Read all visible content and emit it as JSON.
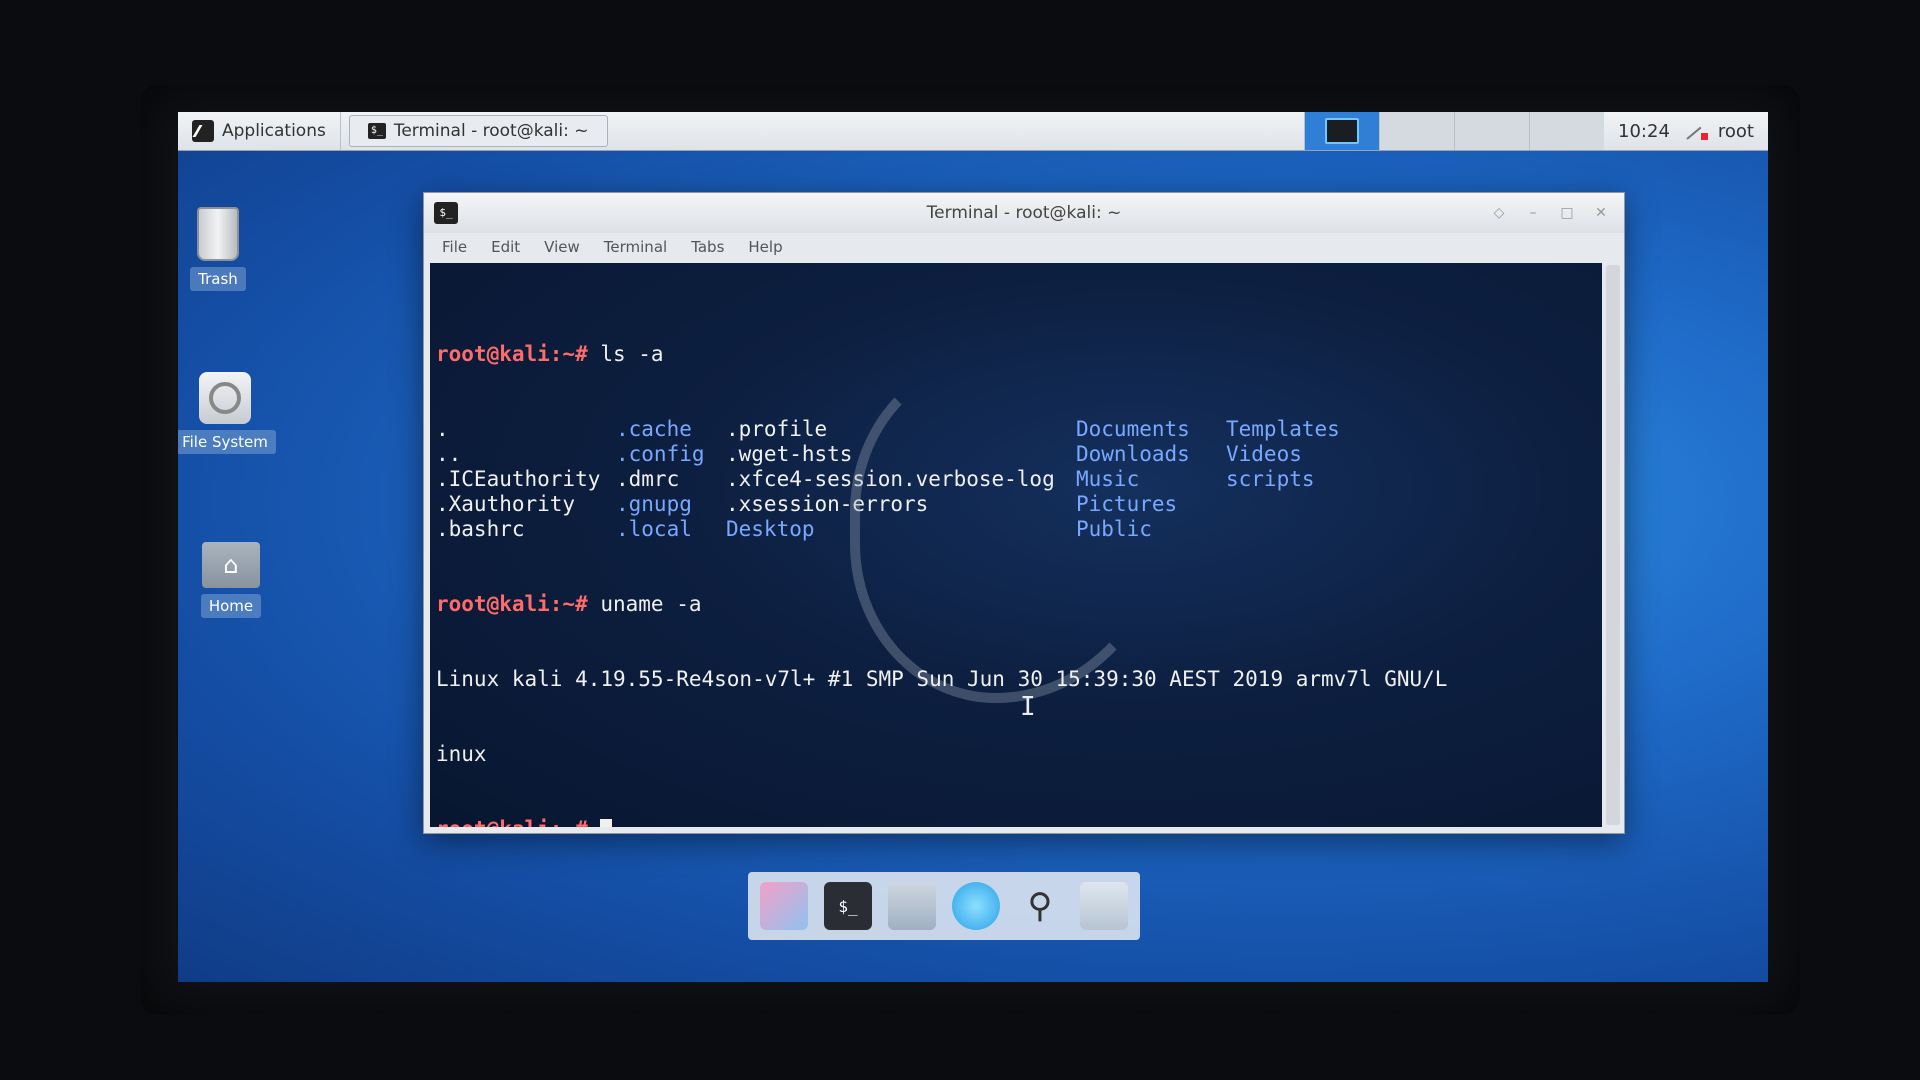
{
  "panel": {
    "applications_label": "Applications",
    "taskbar_label": "Terminal - root@kali: ~",
    "clock": "10:24",
    "user": "root"
  },
  "desktop_icons": {
    "trash": "Trash",
    "filesystem": "File System",
    "home": "Home"
  },
  "window": {
    "title": "Terminal - root@kali: ~",
    "menu": [
      "File",
      "Edit",
      "View",
      "Terminal",
      "Tabs",
      "Help"
    ]
  },
  "terminal": {
    "prompt": "root@kali:~#",
    "cmd1": " ls -a",
    "ls_col1": [
      ".",
      "..",
      ".ICEauthority",
      ".Xauthority",
      ".bashrc"
    ],
    "ls_col2": [
      ".cache",
      ".config",
      ".dmrc",
      ".gnupg",
      ".local"
    ],
    "ls_col3": [
      ".profile",
      ".wget-hsts",
      ".xfce4-session.verbose-log",
      ".xsession-errors",
      "Desktop"
    ],
    "ls_col4": [
      "Documents",
      "Downloads",
      "Music",
      "Pictures",
      "Public"
    ],
    "ls_col5": [
      "Templates",
      "Videos",
      "scripts"
    ],
    "cmd2": " uname -a",
    "uname_line1": "Linux kali 4.19.55-Re4son-v7l+ #1 SMP Sun Jun 30 15:39:30 AEST 2019 armv7l GNU/L",
    "uname_line2": "inux"
  },
  "colors": {
    "prompt": "#ff6a6a",
    "directory": "#79a8ff",
    "desktop_blue": "#1f6cc9"
  }
}
